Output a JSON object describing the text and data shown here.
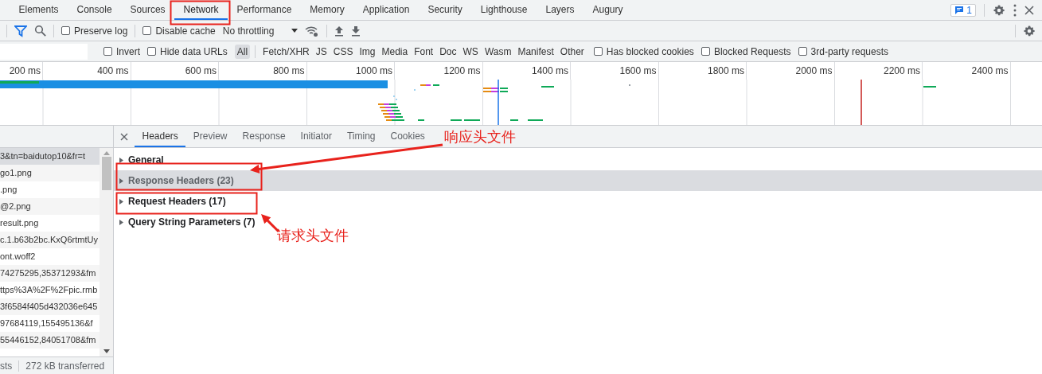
{
  "main_tabs": [
    {
      "label": "Elements",
      "selected": false
    },
    {
      "label": "Console",
      "selected": false
    },
    {
      "label": "Sources",
      "selected": false
    },
    {
      "label": "Network",
      "selected": true
    },
    {
      "label": "Performance",
      "selected": false
    },
    {
      "label": "Memory",
      "selected": false
    },
    {
      "label": "Application",
      "selected": false
    },
    {
      "label": "Security",
      "selected": false
    },
    {
      "label": "Lighthouse",
      "selected": false
    },
    {
      "label": "Layers",
      "selected": false
    },
    {
      "label": "Augury",
      "selected": false
    }
  ],
  "issues_badge": {
    "count": "1"
  },
  "toolbar": {
    "checkboxes": [
      {
        "label": "Preserve log",
        "checked": false
      },
      {
        "label": "Disable cache",
        "checked": false
      }
    ],
    "throttling": "No throttling"
  },
  "filter_bar": {
    "left_checkboxes": [
      {
        "label": "Invert",
        "checked": false
      },
      {
        "label": "Hide data URLs",
        "checked": false
      }
    ],
    "types": [
      {
        "label": "All",
        "selected": true
      },
      {
        "label": "Fetch/XHR",
        "selected": false
      },
      {
        "label": "JS",
        "selected": false
      },
      {
        "label": "CSS",
        "selected": false
      },
      {
        "label": "Img",
        "selected": false
      },
      {
        "label": "Media",
        "selected": false
      },
      {
        "label": "Font",
        "selected": false
      },
      {
        "label": "Doc",
        "selected": false
      },
      {
        "label": "WS",
        "selected": false
      },
      {
        "label": "Wasm",
        "selected": false
      },
      {
        "label": "Manifest",
        "selected": false
      },
      {
        "label": "Other",
        "selected": false
      }
    ],
    "right_checkboxes": [
      {
        "label": "Has blocked cookies",
        "checked": false
      },
      {
        "label": "Blocked Requests",
        "checked": false
      },
      {
        "label": "3rd-party requests",
        "checked": false
      }
    ]
  },
  "timeline": {
    "ticks": [
      "200 ms",
      "400 ms",
      "600 ms",
      "800 ms",
      "1000 ms",
      "1200 ms",
      "1400 ms",
      "1600 ms",
      "1800 ms",
      "2000 ms",
      "2200 ms",
      "2400 ms"
    ]
  },
  "requests": {
    "rows": [
      {
        "name": "3&tn=baidutop10&fr=t",
        "selected": true
      },
      {
        "name": "go1.png",
        "selected": false
      },
      {
        "name": ".png",
        "selected": false
      },
      {
        "name": "@2.png",
        "selected": false
      },
      {
        "name": "result.png",
        "selected": false
      },
      {
        "name": "c.1.b63b2bc.KxQ6rtmtUy",
        "selected": false
      },
      {
        "name": "ont.woff2",
        "selected": false
      },
      {
        "name": "74275295,35371293&fm",
        "selected": false
      },
      {
        "name": "ttps%3A%2F%2Fpic.rmb",
        "selected": false
      },
      {
        "name": "3f6584f405d432036e645",
        "selected": false
      },
      {
        "name": "97684119,155495136&f",
        "selected": false
      },
      {
        "name": "55446152,84051708&fm",
        "selected": false
      }
    ],
    "status": [
      "sts",
      "272 kB transferred"
    ]
  },
  "details": {
    "tabs": [
      {
        "label": "Headers",
        "selected": true
      },
      {
        "label": "Preview",
        "selected": false
      },
      {
        "label": "Response",
        "selected": false
      },
      {
        "label": "Initiator",
        "selected": false
      },
      {
        "label": "Timing",
        "selected": false
      },
      {
        "label": "Cookies",
        "selected": false
      }
    ],
    "sections": [
      {
        "title": "General",
        "expanded": false,
        "selected": false
      },
      {
        "title": "Response Headers (23)",
        "expanded": false,
        "selected": true
      },
      {
        "title": "Request Headers (17)",
        "expanded": false,
        "selected": false
      },
      {
        "title": "Query String Parameters (7)",
        "expanded": false,
        "selected": false
      }
    ]
  },
  "annotations": [
    "响应头文件",
    "请求头文件"
  ]
}
